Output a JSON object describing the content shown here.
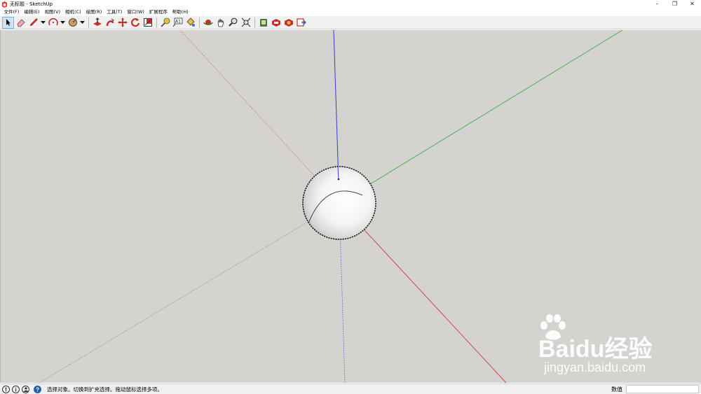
{
  "window": {
    "title": "无标题 - SketchUp",
    "minimize_glyph": "–",
    "restore_glyph": "❐",
    "close_glyph": "✕"
  },
  "menu": {
    "items": [
      "文件(F)",
      "编辑(E)",
      "视图(V)",
      "相机(C)",
      "绘图(R)",
      "工具(T)",
      "窗口(W)",
      "扩展程序",
      "帮助(H)"
    ]
  },
  "toolbar": {
    "tools": [
      {
        "name": "select-tool-icon"
      },
      {
        "name": "eraser-tool-icon"
      },
      {
        "name": "pencil-line-tool-icon"
      },
      {
        "name": "arc-tool-icon"
      },
      {
        "name": "shape-tool-icon"
      },
      {
        "name": "push-pull-tool-icon"
      },
      {
        "name": "follow-me-tool-icon"
      },
      {
        "name": "move-tool-icon"
      },
      {
        "name": "rotate-tool-icon"
      },
      {
        "name": "scale-tool-icon"
      },
      {
        "name": "tape-measure-tool-icon"
      },
      {
        "name": "text-tool-icon"
      },
      {
        "name": "paint-bucket-tool-icon"
      },
      {
        "name": "orbit-tool-icon"
      },
      {
        "name": "pan-tool-icon"
      },
      {
        "name": "zoom-tool-icon"
      },
      {
        "name": "zoom-extents-tool-icon"
      },
      {
        "name": "warehouse-icon"
      },
      {
        "name": "extension-warehouse-icon"
      },
      {
        "name": "layout-icon"
      },
      {
        "name": "send-to-layout-icon"
      }
    ],
    "text_tool_glyph": "A1"
  },
  "colors": {
    "viewport_bg": "#d4d3cf",
    "axis_red": "#c84b4b",
    "axis_green": "#4caf50",
    "axis_blue": "#3a3ad8",
    "select_highlight": "#cce4f7"
  },
  "watermark": {
    "brand": "Baidu经验",
    "url": "jingyan.baidu.com"
  },
  "statusbar": {
    "icons": [
      "geo-location-icon",
      "credits-info-icon",
      "user-account-icon",
      "help-icon"
    ],
    "message": "选择对象。切换到扩充选择。拖动鼠标选择多项。",
    "measurements_label": "数值",
    "measurements_value": ""
  }
}
